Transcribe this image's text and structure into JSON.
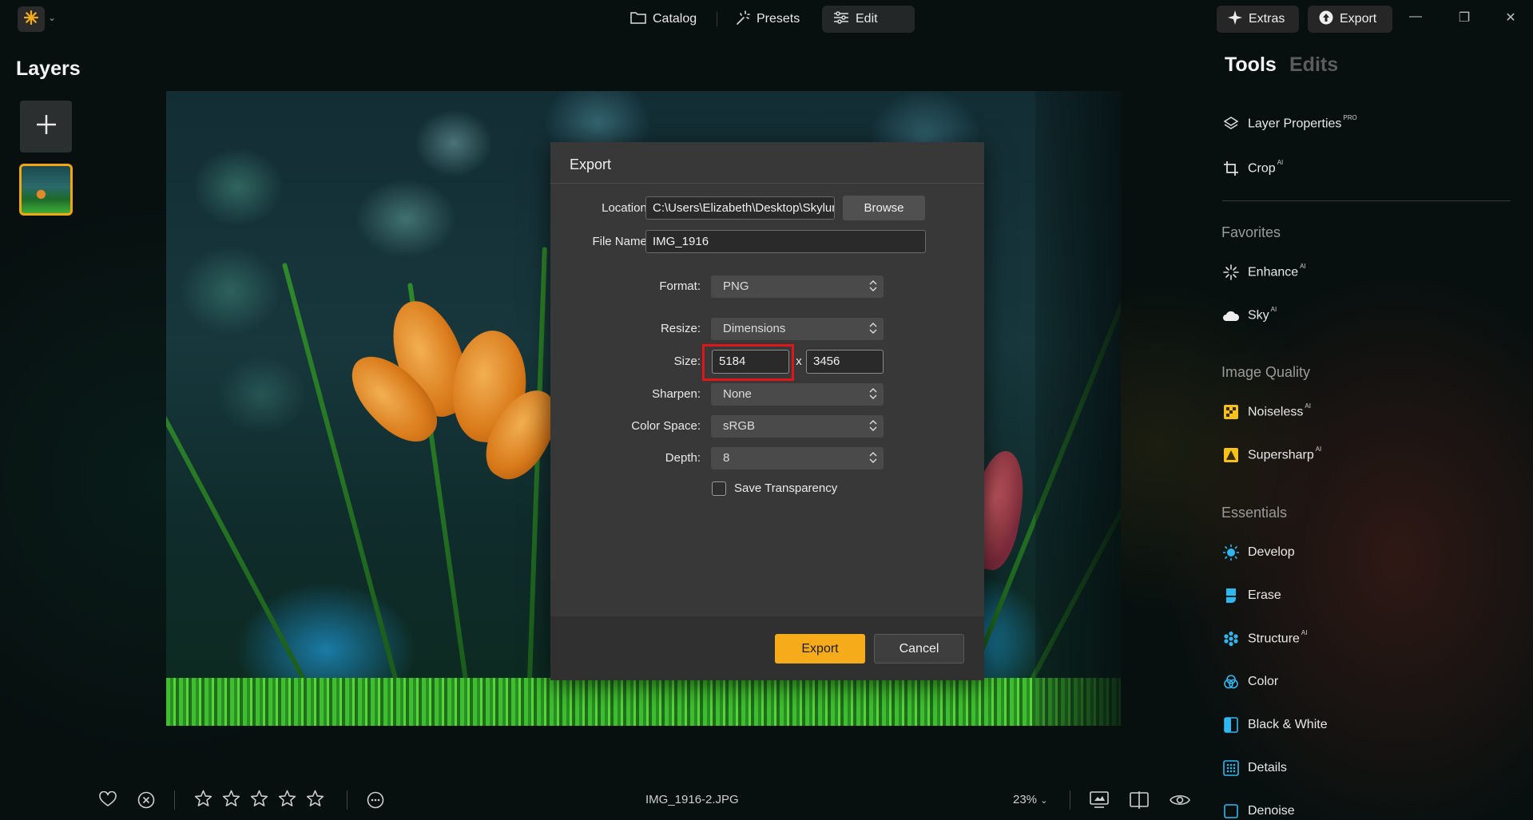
{
  "topbar": {
    "nav": [
      {
        "label": "Catalog",
        "icon": "folder-icon"
      },
      {
        "label": "Presets",
        "icon": "sparkle-wand-icon"
      },
      {
        "label": "Edit",
        "icon": "sliders-icon"
      }
    ],
    "extras_label": "Extras",
    "export_label": "Export"
  },
  "layers": {
    "title": "Layers"
  },
  "dialog": {
    "title": "Export",
    "location_label": "Location:",
    "location_value": "C:\\Users\\Elizabeth\\Desktop\\Skylum",
    "browse_label": "Browse",
    "filename_label": "File Name:",
    "filename_value": "IMG_1916",
    "format_label": "Format:",
    "format_value": "PNG",
    "resize_label": "Resize:",
    "resize_value": "Dimensions",
    "size_label": "Size:",
    "width_value": "5184",
    "size_x": "x",
    "height_value": "3456",
    "sharpen_label": "Sharpen:",
    "sharpen_value": "None",
    "colorspace_label": "Color Space:",
    "colorspace_value": "sRGB",
    "depth_label": "Depth:",
    "depth_value": "8",
    "transparency_label": "Save Transparency",
    "transparency_checked": false,
    "export_button": "Export",
    "cancel_button": "Cancel",
    "accent_color": "#f6ac1a",
    "highlight_color": "#e0161b"
  },
  "right_panel": {
    "tab_tools": "Tools",
    "tab_edits": "Edits",
    "top_tools": [
      {
        "label": "Layer Properties",
        "badge": "PRO",
        "icon": "layers-icon"
      },
      {
        "label": "Crop",
        "badge": "AI",
        "icon": "crop-icon"
      }
    ],
    "sections": [
      {
        "title": "Favorites",
        "tools": [
          {
            "label": "Enhance",
            "badge": "AI",
            "icon": "enhance-sparkle-icon"
          },
          {
            "label": "Sky",
            "badge": "AI",
            "icon": "cloud-icon"
          }
        ]
      },
      {
        "title": "Image Quality",
        "tools": [
          {
            "label": "Noiseless",
            "badge": "AI",
            "icon": "noiseless-icon"
          },
          {
            "label": "Supersharp",
            "badge": "AI",
            "icon": "supersharp-icon"
          }
        ]
      },
      {
        "title": "Essentials",
        "tools": [
          {
            "label": "Develop",
            "badge": "",
            "icon": "sun-icon"
          },
          {
            "label": "Erase",
            "badge": "",
            "icon": "eraser-icon"
          },
          {
            "label": "Structure",
            "badge": "AI",
            "icon": "structure-icon"
          },
          {
            "label": "Color",
            "badge": "",
            "icon": "color-circles-icon"
          },
          {
            "label": "Black & White",
            "badge": "",
            "icon": "bw-icon"
          },
          {
            "label": "Details",
            "badge": "",
            "icon": "details-grid-icon"
          },
          {
            "label": "Denoise",
            "badge": "",
            "icon": "denoise-icon"
          }
        ]
      }
    ]
  },
  "bottombar": {
    "filename": "IMG_1916-2.JPG",
    "zoom": "23%",
    "rating_stars": 5
  }
}
